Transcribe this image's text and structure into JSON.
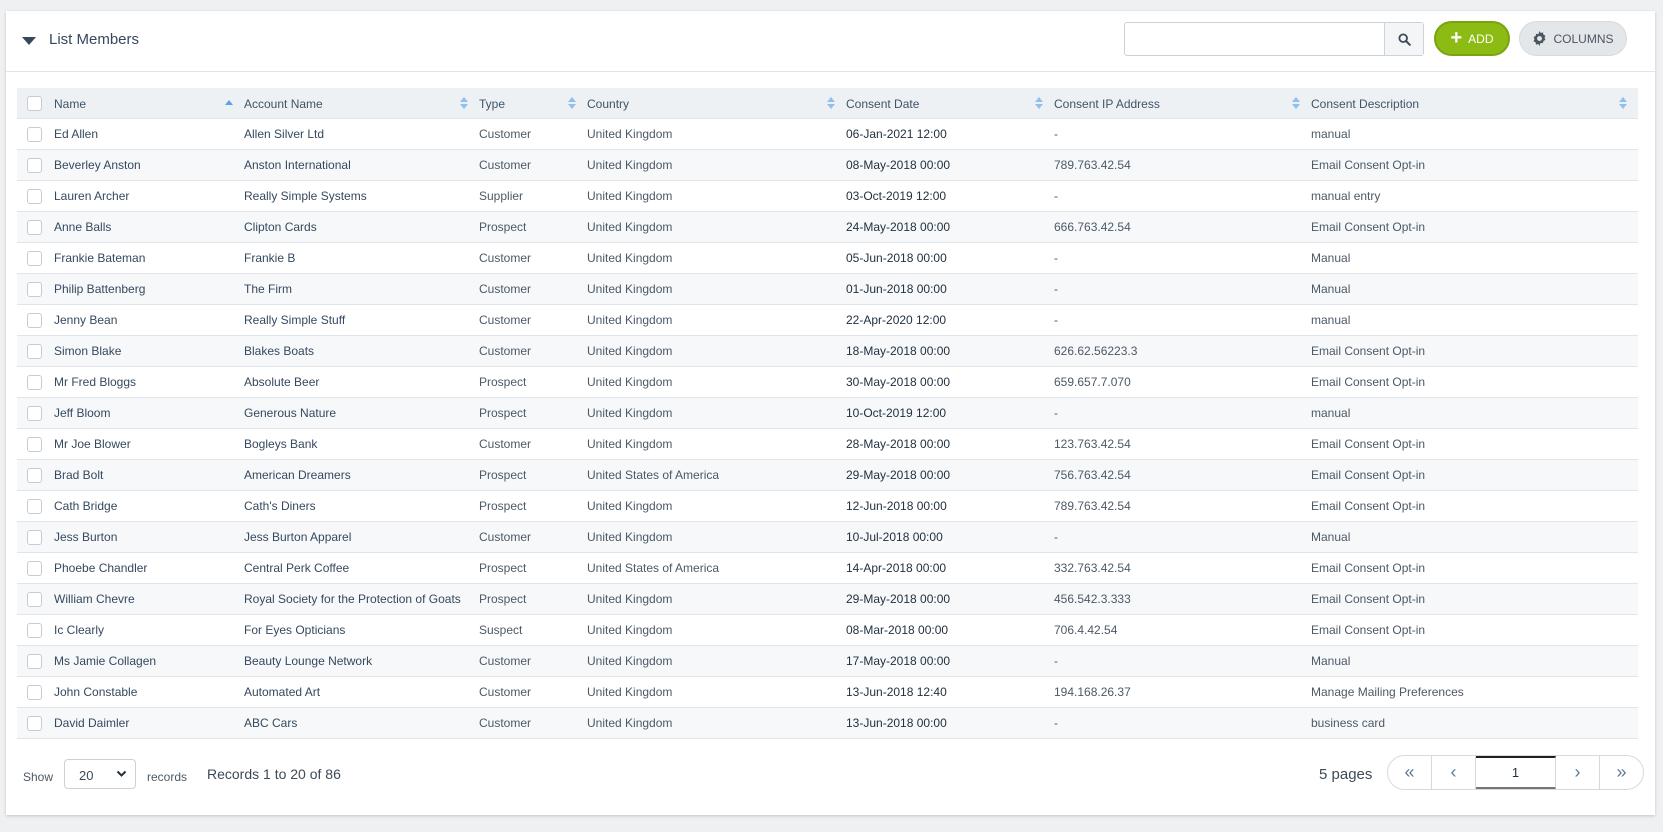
{
  "header": {
    "title": "List Members",
    "search": {
      "value": "",
      "placeholder": ""
    },
    "add_label": "ADD",
    "columns_label": "COLUMNS"
  },
  "colors": {
    "accent_green": "#8cbb14",
    "sort_icon_blue": "#5aa3e8",
    "header_bg": "#eef1f4"
  },
  "table": {
    "sorted_column": "Name",
    "sort_direction": "ascending",
    "columns": [
      "Name",
      "Account Name",
      "Type",
      "Country",
      "Consent Date",
      "Consent IP Address",
      "Consent Description"
    ],
    "rows": [
      [
        "Ed Allen",
        "Allen Silver Ltd",
        "Customer",
        "United Kingdom",
        "06-Jan-2021 12:00",
        "-",
        "manual"
      ],
      [
        "Beverley Anston",
        "Anston International",
        "Customer",
        "United Kingdom",
        "08-May-2018 00:00",
        "789.763.42.54",
        "Email Consent Opt-in"
      ],
      [
        "Lauren Archer",
        "Really Simple Systems",
        "Supplier",
        "United Kingdom",
        "03-Oct-2019 12:00",
        "-",
        "manual entry"
      ],
      [
        "Anne Balls",
        "Clipton Cards",
        "Prospect",
        "United Kingdom",
        "24-May-2018 00:00",
        "666.763.42.54",
        "Email Consent Opt-in"
      ],
      [
        "Frankie Bateman",
        "Frankie B",
        "Customer",
        "United Kingdom",
        "05-Jun-2018 00:00",
        "-",
        "Manual"
      ],
      [
        "Philip Battenberg",
        "The Firm",
        "Customer",
        "United Kingdom",
        "01-Jun-2018 00:00",
        "-",
        "Manual"
      ],
      [
        "Jenny Bean",
        "Really Simple Stuff",
        "Customer",
        "United Kingdom",
        "22-Apr-2020 12:00",
        "-",
        "manual"
      ],
      [
        "Simon Blake",
        "Blakes Boats",
        "Customer",
        "United Kingdom",
        "18-May-2018 00:00",
        "626.62.56223.3",
        "Email Consent Opt-in"
      ],
      [
        "Mr Fred Bloggs",
        "Absolute Beer",
        "Prospect",
        "United Kingdom",
        "30-May-2018 00:00",
        "659.657.7.070",
        "Email Consent Opt-in"
      ],
      [
        "Jeff Bloom",
        "Generous Nature",
        "Prospect",
        "United Kingdom",
        "10-Oct-2019 12:00",
        "-",
        "manual"
      ],
      [
        "Mr Joe Blower",
        "Bogleys Bank",
        "Customer",
        "United Kingdom",
        "28-May-2018 00:00",
        "123.763.42.54",
        "Email Consent Opt-in"
      ],
      [
        "Brad Bolt",
        "American Dreamers",
        "Prospect",
        "United States of America",
        "29-May-2018 00:00",
        "756.763.42.54",
        "Email Consent Opt-in"
      ],
      [
        "Cath Bridge",
        "Cath's Diners",
        "Prospect",
        "United Kingdom",
        "12-Jun-2018 00:00",
        "789.763.42.54",
        "Email Consent Opt-in"
      ],
      [
        "Jess Burton",
        "Jess Burton Apparel",
        "Customer",
        "United Kingdom",
        "10-Jul-2018 00:00",
        "-",
        "Manual"
      ],
      [
        "Phoebe Chandler",
        "Central Perk Coffee",
        "Prospect",
        "United States of America",
        "14-Apr-2018 00:00",
        "332.763.42.54",
        "Email Consent Opt-in"
      ],
      [
        "William Chevre",
        "Royal Society for the Protection of Goats",
        "Prospect",
        "United Kingdom",
        "29-May-2018 00:00",
        "456.542.3.333",
        "Email Consent Opt-in"
      ],
      [
        "Ic Clearly",
        "For Eyes Opticians",
        "Suspect",
        "United Kingdom",
        "08-Mar-2018 00:00",
        "706.4.42.54",
        "Email Consent Opt-in"
      ],
      [
        "Ms Jamie Collagen",
        "Beauty Lounge Network",
        "Customer",
        "United Kingdom",
        "17-May-2018 00:00",
        "-",
        "Manual"
      ],
      [
        "John Constable",
        "Automated Art",
        "Customer",
        "United Kingdom",
        "13-Jun-2018 12:40",
        "194.168.26.37",
        "Manage Mailing Preferences"
      ],
      [
        "David Daimler",
        "ABC Cars",
        "Customer",
        "United Kingdom",
        "13-Jun-2018 00:00",
        "-",
        "business card"
      ]
    ]
  },
  "footer": {
    "show_label": "Show",
    "page_size": "20",
    "records_label": "records",
    "records_info": "Records 1 to 20 of 86",
    "pages_count": "5 pages",
    "current_page": "1"
  }
}
